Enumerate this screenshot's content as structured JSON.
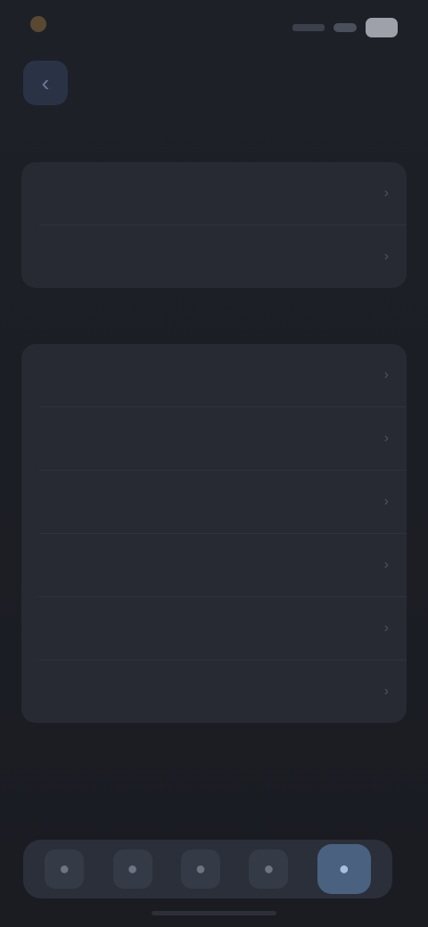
{
  "status": {
    "time": "",
    "carrier": ""
  },
  "nav": {
    "back_icon": "chevron-left-icon",
    "title": ""
  },
  "sections": [
    {
      "label": "",
      "rows": [
        {
          "label": "",
          "value": ""
        },
        {
          "label": "",
          "value": ""
        }
      ]
    },
    {
      "label": "",
      "rows": [
        {
          "label": "",
          "value": ""
        },
        {
          "label": "",
          "value": ""
        },
        {
          "label": "",
          "value": ""
        },
        {
          "label": "",
          "value": ""
        },
        {
          "label": "",
          "value": ""
        },
        {
          "label": "",
          "value": ""
        }
      ]
    }
  ],
  "footnote": "",
  "tabbar": {
    "tabs": [
      {
        "icon": "tab-icon-1",
        "active": false
      },
      {
        "icon": "tab-icon-2",
        "active": false
      },
      {
        "icon": "tab-icon-3",
        "active": false
      },
      {
        "icon": "tab-icon-4",
        "active": false
      },
      {
        "icon": "tab-icon-5",
        "active": true
      }
    ]
  },
  "colors": {
    "background": "#1b1d24",
    "card": "#272a33",
    "accent": "#4a6280"
  }
}
